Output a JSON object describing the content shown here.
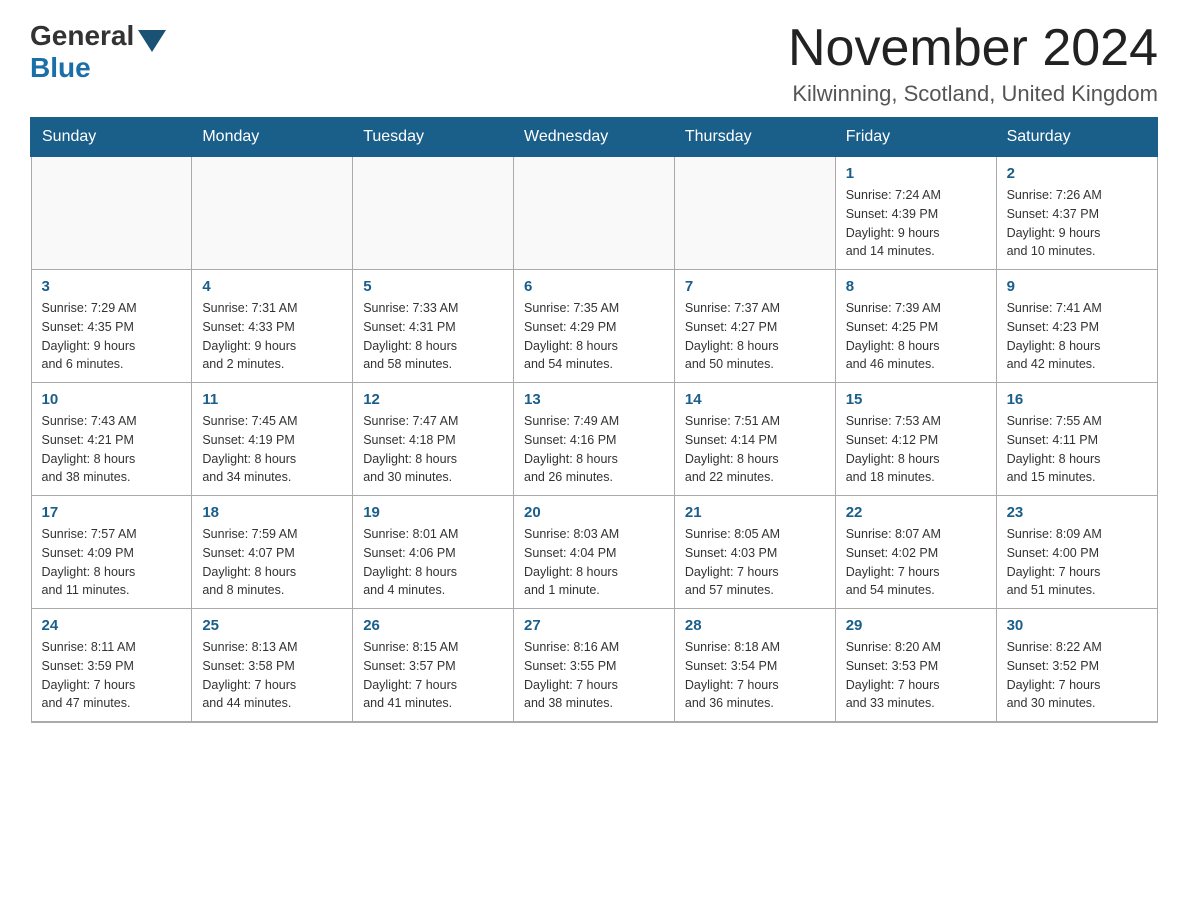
{
  "header": {
    "logo_general": "General",
    "logo_blue": "Blue",
    "month_title": "November 2024",
    "subtitle": "Kilwinning, Scotland, United Kingdom"
  },
  "weekdays": [
    "Sunday",
    "Monday",
    "Tuesday",
    "Wednesday",
    "Thursday",
    "Friday",
    "Saturday"
  ],
  "weeks": [
    [
      {
        "day": "",
        "info": ""
      },
      {
        "day": "",
        "info": ""
      },
      {
        "day": "",
        "info": ""
      },
      {
        "day": "",
        "info": ""
      },
      {
        "day": "",
        "info": ""
      },
      {
        "day": "1",
        "info": "Sunrise: 7:24 AM\nSunset: 4:39 PM\nDaylight: 9 hours\nand 14 minutes."
      },
      {
        "day": "2",
        "info": "Sunrise: 7:26 AM\nSunset: 4:37 PM\nDaylight: 9 hours\nand 10 minutes."
      }
    ],
    [
      {
        "day": "3",
        "info": "Sunrise: 7:29 AM\nSunset: 4:35 PM\nDaylight: 9 hours\nand 6 minutes."
      },
      {
        "day": "4",
        "info": "Sunrise: 7:31 AM\nSunset: 4:33 PM\nDaylight: 9 hours\nand 2 minutes."
      },
      {
        "day": "5",
        "info": "Sunrise: 7:33 AM\nSunset: 4:31 PM\nDaylight: 8 hours\nand 58 minutes."
      },
      {
        "day": "6",
        "info": "Sunrise: 7:35 AM\nSunset: 4:29 PM\nDaylight: 8 hours\nand 54 minutes."
      },
      {
        "day": "7",
        "info": "Sunrise: 7:37 AM\nSunset: 4:27 PM\nDaylight: 8 hours\nand 50 minutes."
      },
      {
        "day": "8",
        "info": "Sunrise: 7:39 AM\nSunset: 4:25 PM\nDaylight: 8 hours\nand 46 minutes."
      },
      {
        "day": "9",
        "info": "Sunrise: 7:41 AM\nSunset: 4:23 PM\nDaylight: 8 hours\nand 42 minutes."
      }
    ],
    [
      {
        "day": "10",
        "info": "Sunrise: 7:43 AM\nSunset: 4:21 PM\nDaylight: 8 hours\nand 38 minutes."
      },
      {
        "day": "11",
        "info": "Sunrise: 7:45 AM\nSunset: 4:19 PM\nDaylight: 8 hours\nand 34 minutes."
      },
      {
        "day": "12",
        "info": "Sunrise: 7:47 AM\nSunset: 4:18 PM\nDaylight: 8 hours\nand 30 minutes."
      },
      {
        "day": "13",
        "info": "Sunrise: 7:49 AM\nSunset: 4:16 PM\nDaylight: 8 hours\nand 26 minutes."
      },
      {
        "day": "14",
        "info": "Sunrise: 7:51 AM\nSunset: 4:14 PM\nDaylight: 8 hours\nand 22 minutes."
      },
      {
        "day": "15",
        "info": "Sunrise: 7:53 AM\nSunset: 4:12 PM\nDaylight: 8 hours\nand 18 minutes."
      },
      {
        "day": "16",
        "info": "Sunrise: 7:55 AM\nSunset: 4:11 PM\nDaylight: 8 hours\nand 15 minutes."
      }
    ],
    [
      {
        "day": "17",
        "info": "Sunrise: 7:57 AM\nSunset: 4:09 PM\nDaylight: 8 hours\nand 11 minutes."
      },
      {
        "day": "18",
        "info": "Sunrise: 7:59 AM\nSunset: 4:07 PM\nDaylight: 8 hours\nand 8 minutes."
      },
      {
        "day": "19",
        "info": "Sunrise: 8:01 AM\nSunset: 4:06 PM\nDaylight: 8 hours\nand 4 minutes."
      },
      {
        "day": "20",
        "info": "Sunrise: 8:03 AM\nSunset: 4:04 PM\nDaylight: 8 hours\nand 1 minute."
      },
      {
        "day": "21",
        "info": "Sunrise: 8:05 AM\nSunset: 4:03 PM\nDaylight: 7 hours\nand 57 minutes."
      },
      {
        "day": "22",
        "info": "Sunrise: 8:07 AM\nSunset: 4:02 PM\nDaylight: 7 hours\nand 54 minutes."
      },
      {
        "day": "23",
        "info": "Sunrise: 8:09 AM\nSunset: 4:00 PM\nDaylight: 7 hours\nand 51 minutes."
      }
    ],
    [
      {
        "day": "24",
        "info": "Sunrise: 8:11 AM\nSunset: 3:59 PM\nDaylight: 7 hours\nand 47 minutes."
      },
      {
        "day": "25",
        "info": "Sunrise: 8:13 AM\nSunset: 3:58 PM\nDaylight: 7 hours\nand 44 minutes."
      },
      {
        "day": "26",
        "info": "Sunrise: 8:15 AM\nSunset: 3:57 PM\nDaylight: 7 hours\nand 41 minutes."
      },
      {
        "day": "27",
        "info": "Sunrise: 8:16 AM\nSunset: 3:55 PM\nDaylight: 7 hours\nand 38 minutes."
      },
      {
        "day": "28",
        "info": "Sunrise: 8:18 AM\nSunset: 3:54 PM\nDaylight: 7 hours\nand 36 minutes."
      },
      {
        "day": "29",
        "info": "Sunrise: 8:20 AM\nSunset: 3:53 PM\nDaylight: 7 hours\nand 33 minutes."
      },
      {
        "day": "30",
        "info": "Sunrise: 8:22 AM\nSunset: 3:52 PM\nDaylight: 7 hours\nand 30 minutes."
      }
    ]
  ]
}
